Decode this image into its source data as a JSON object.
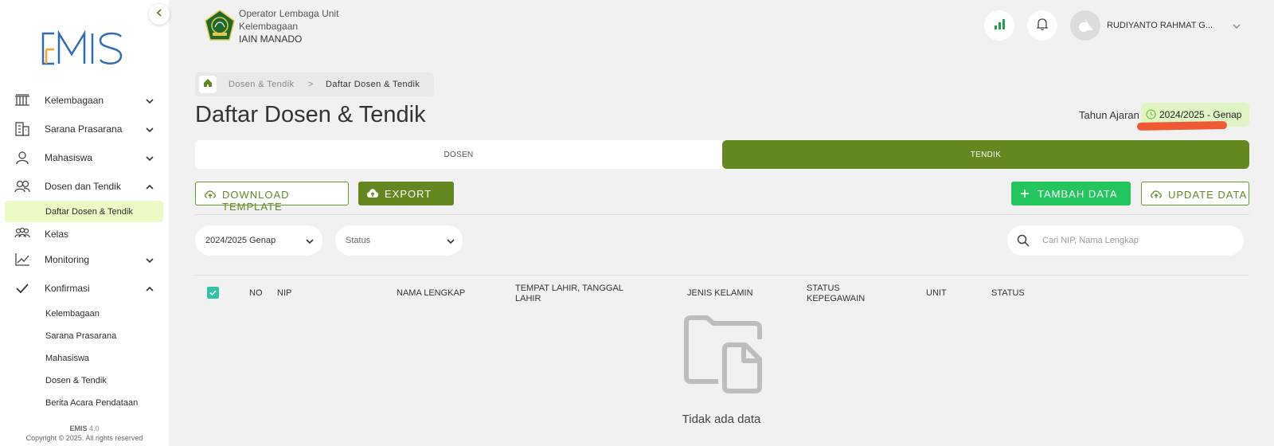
{
  "app": {
    "name": "EMIS",
    "version": "4.0"
  },
  "sidebar": {
    "items": [
      {
        "label": "Kelembagaan"
      },
      {
        "label": "Sarana Prasarana"
      },
      {
        "label": "Mahasiswa"
      },
      {
        "label": "Dosen dan Tendik"
      },
      {
        "label": "Kelas"
      },
      {
        "label": "Monitoring"
      },
      {
        "label": "Konfirmasi"
      }
    ],
    "dosen_sub": [
      "Daftar Dosen & Tendik"
    ],
    "konfirmasi_sub": [
      "Kelembagaan",
      "Sarana Prasarana",
      "Mahasiswa",
      "Dosen & Tendik",
      "Berita Acara Pendataan"
    ],
    "footer": {
      "app": "EMIS",
      "version": "4.0",
      "copyright": "Copyright © 2025. All rights reserved"
    }
  },
  "header": {
    "org_line1": "Operator Lembaga Unit",
    "org_line2": "Kelembagaan",
    "org_name": "IAIN MANADO",
    "user_name": "RUDIYANTO RAHMAT G..."
  },
  "breadcrumb": {
    "item1": "Dosen & Tendik",
    "separator": ">",
    "item2": "Daftar Dosen & Tendik"
  },
  "page": {
    "title": "Daftar Dosen & Tendik",
    "year_label": "Tahun Ajaran",
    "year_value": "2024/2025 - Genap"
  },
  "tabs": [
    {
      "label": "DOSEN"
    },
    {
      "label": "TENDIK"
    }
  ],
  "actions": {
    "download_template": "DOWNLOAD TEMPLATE",
    "export": "EXPORT",
    "tambah": "TAMBAH DATA",
    "update": "UPDATE DATA"
  },
  "filters": {
    "year_select": "2024/2025 Genap",
    "status_select": "Status",
    "search_placeholder": "Cari NIP, Nama Lengkap"
  },
  "table": {
    "headers": {
      "no": "NO",
      "nip": "NIP",
      "nama": "NAMA LENGKAP",
      "ttl_1": "TEMPAT LAHIR, TANGGAL",
      "ttl_2": "LAHIR",
      "jk": "JENIS KELAMIN",
      "sk_1": "STATUS",
      "sk_2": "KEPEGAWAIN",
      "unit": "UNIT",
      "status": "STATUS"
    },
    "empty_text": "Tidak ada data"
  },
  "colors": {
    "primary": "#64881f",
    "accent_green": "#22c55e",
    "active_bg": "#ecfbc6",
    "badge_bg": "#dff6c4",
    "annotation": "#ef5a35",
    "logo_blue": "#2e6cb8",
    "logo_orange": "#f5a623"
  },
  "icons": [
    "chevron-left-icon",
    "building-icon",
    "facility-icon",
    "user-icon",
    "users-icon",
    "group-icon",
    "chart-icon",
    "check-icon",
    "home-icon",
    "clock-icon",
    "signal-icon",
    "bell-icon",
    "cloud-upload-icon",
    "plus-icon",
    "search-icon",
    "empty-folder-icon"
  ]
}
